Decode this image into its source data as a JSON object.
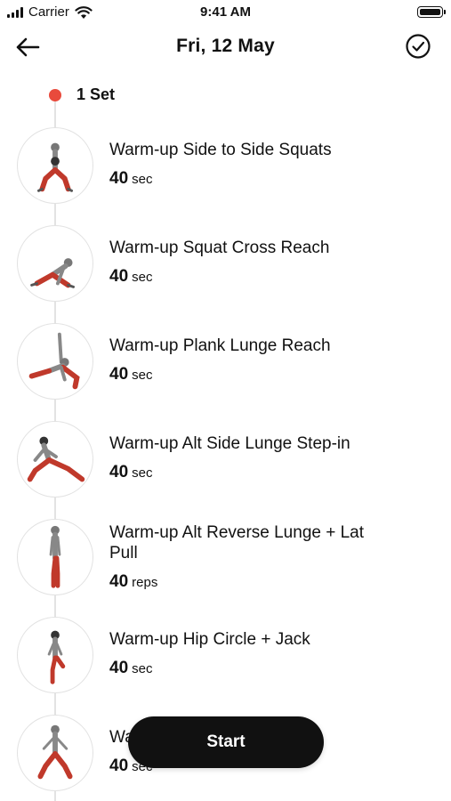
{
  "status_bar": {
    "carrier": "Carrier",
    "time": "9:41 AM"
  },
  "header": {
    "title": "Fri, 12 May"
  },
  "set": {
    "label": "1 Set",
    "dot_color": "#e94a3c"
  },
  "exercises": [
    {
      "name": "Warm-up Side to Side Squats",
      "value": "40",
      "unit": "sec"
    },
    {
      "name": "Warm-up Squat Cross Reach",
      "value": "40",
      "unit": "sec"
    },
    {
      "name": "Warm-up Plank Lunge Reach",
      "value": "40",
      "unit": "sec"
    },
    {
      "name": "Warm-up Alt Side Lunge Step-in",
      "value": "40",
      "unit": "sec"
    },
    {
      "name": "Warm-up Alt Reverse Lunge + Lat Pull",
      "value": "40",
      "unit": "reps"
    },
    {
      "name": "Warm-up Hip Circle + Jack",
      "value": "40",
      "unit": "sec"
    },
    {
      "name": "Warm-up Squat Jacks",
      "value": "40",
      "unit": "sec"
    }
  ],
  "start_button": {
    "label": "Start"
  },
  "colors": {
    "accent": "#e94a3c",
    "muscle": "#c0392b",
    "button_bg": "#111111"
  },
  "icons": {
    "back": "arrow-left-icon",
    "done": "check-circle-icon",
    "signal": "cellular-signal-icon",
    "wifi": "wifi-icon",
    "battery": "battery-icon"
  }
}
